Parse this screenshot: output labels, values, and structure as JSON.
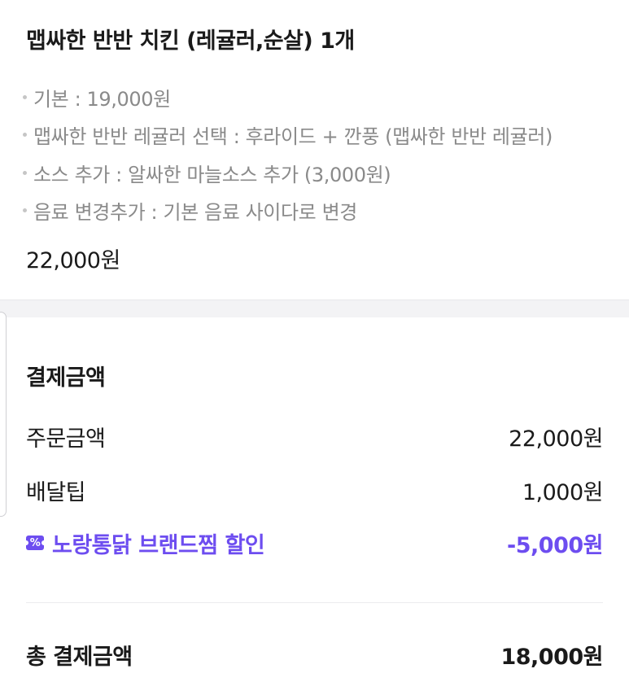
{
  "order_item": {
    "title": "맵싸한 반반 치킨 (레귤러,순살) 1개",
    "options": [
      "기본 : 19,000원",
      "맵싸한 반반 레귤러 선택 : 후라이드 + 깐풍 (맵싸한 반반 레귤러)",
      "소스 추가 : 알싸한 마늘소스 추가 (3,000원)",
      "음료 변경추가 : 기본 음료 사이다로 변경"
    ],
    "price": "22,000원"
  },
  "payment": {
    "title": "결제금액",
    "order_amount": {
      "label": "주문금액",
      "value": "22,000원"
    },
    "delivery_tip": {
      "label": "배달팁",
      "value": "1,000원"
    },
    "discount": {
      "icon": "coupon-icon",
      "icon_glyph": "%",
      "label": "노랑통닭 브랜드찜 할인",
      "value": "-5,000원",
      "color": "#6d4df0"
    },
    "total": {
      "label": "총 결제금액",
      "value": "18,000원"
    }
  }
}
